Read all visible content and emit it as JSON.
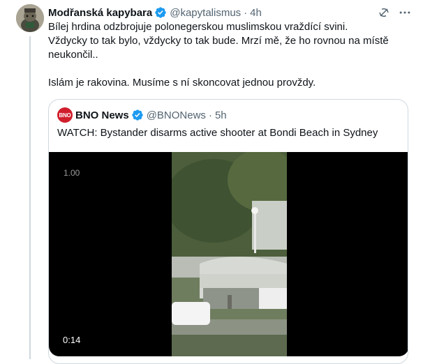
{
  "tweet": {
    "author_name": "Modřanská kapybara",
    "handle": "@kapytalismus",
    "separator": "·",
    "time": "4h",
    "text_lines": [
      "Bílej hrdina odzbrojuje polonegerskou muslimskou vraždící svini.",
      "Vždycky to tak bylo, vždycky to tak bude. Mrzí mě, že ho rovnou na místě",
      "neukončil..",
      "Islám je rakovina. Musíme s ní skoncovat jednou provždy."
    ],
    "icons": [
      "avatar",
      "verified-badge-icon",
      "grok-icon",
      "more-icon"
    ]
  },
  "quoted": {
    "avatar_text": "BNO",
    "author_name": "BNO News",
    "handle": "@BNONews",
    "separator": "·",
    "time": "5h",
    "text": "WATCH: Bystander disarms active shooter at Bondi Beach in Sydney",
    "video": {
      "playback_speed": "1.00",
      "duration": "0:14"
    }
  },
  "colors": {
    "text": "#0f1419",
    "secondary": "#536471",
    "verified": "#1d9bf0",
    "border": "#cfd9de",
    "bno_red": "#d01e2c"
  }
}
